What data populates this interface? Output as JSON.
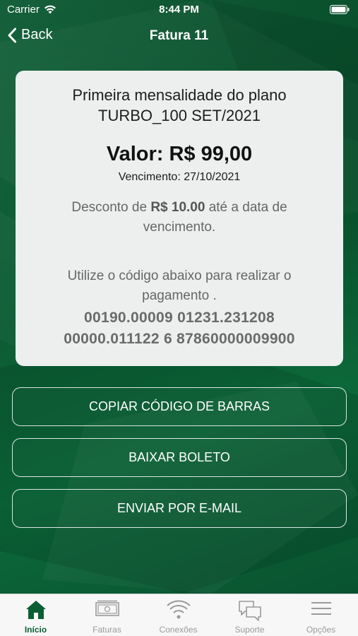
{
  "status_bar": {
    "carrier": "Carrier",
    "time": "8:44 PM"
  },
  "nav": {
    "back_label": "Back",
    "title": "Fatura 11"
  },
  "invoice": {
    "description_line1": "Primeira mensalidade do plano",
    "description_line2": "TURBO_100 SET/2021",
    "value": "Valor: R$ 99,00",
    "due_date": "Vencimento: 27/10/2021",
    "discount_prefix": "Desconto de ",
    "discount_amount": "R$ 10.00",
    "discount_suffix": " até a data de vencimento.",
    "instruction": "Utilize o código abaixo para realizar o pagamento .",
    "barcode_line1": "00190.00009 01231.231208",
    "barcode_line2": "00000.011122 6 87860000009900"
  },
  "actions": {
    "copy_barcode": "COPIAR CÓDIGO DE BARRAS",
    "download_slip": "BAIXAR BOLETO",
    "send_email": "ENVIAR POR E-MAIL"
  },
  "tabbar": {
    "items": [
      {
        "label": "Início",
        "icon": "home-icon",
        "active": true
      },
      {
        "label": "Faturas",
        "icon": "invoice-icon",
        "active": false
      },
      {
        "label": "Conexões",
        "icon": "wifi-icon",
        "active": false
      },
      {
        "label": "Suporte",
        "icon": "chat-icon",
        "active": false
      },
      {
        "label": "Opções",
        "icon": "menu-icon",
        "active": false
      }
    ]
  },
  "colors": {
    "brand_green": "#0b5a33",
    "active_tab": "#0b5f33",
    "inactive_tab": "#9a9a9a"
  }
}
